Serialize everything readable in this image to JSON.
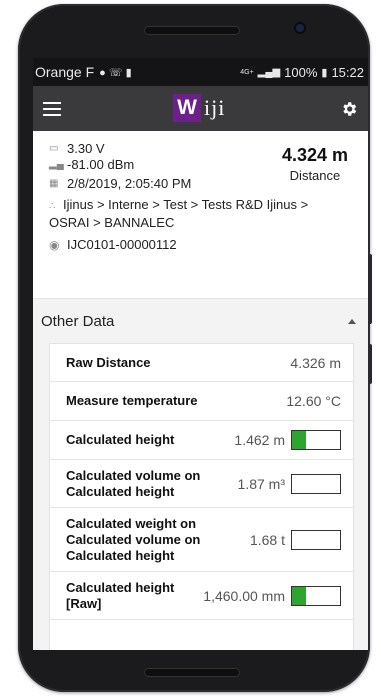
{
  "status": {
    "carrier": "Orange F",
    "battery": "100%",
    "network": "4G+",
    "time": "15:22"
  },
  "appbar": {
    "logo_mark": "W",
    "logo_text": "iji",
    "brand_color": "#6d1f8a"
  },
  "summary": {
    "voltage": "3.30 V",
    "signal": "-81.00 dBm",
    "datetime": "2/8/2019, 2:05:40 PM",
    "path": "Ijinus > Interne > Test > Tests R&D Ijinus > OSRAI > BANNALEC",
    "device_id": "IJC0101-00000112",
    "distance_value": "4.324 m",
    "distance_label": "Distance"
  },
  "other_data": {
    "title": "Other Data",
    "rows": [
      {
        "label": "Raw Distance",
        "value": "4.326 m"
      },
      {
        "label": "Measure temperature",
        "value": "12.60 °C"
      },
      {
        "label": "Calculated height",
        "value": "1.462 m",
        "level": 0.3
      },
      {
        "label": "Calculated volume on Calculated height",
        "value": "1.87 m³",
        "level": 0.0
      },
      {
        "label": "Calculated weight on Calculated volume on Calculated height",
        "value": "1.68 t",
        "level": 0.0
      },
      {
        "label": "Calculated height [Raw]",
        "value": "1,460.00 mm",
        "level": 0.3
      }
    ]
  },
  "colors": {
    "gauge_fill": "#2ea52e",
    "appbar_bg": "#3a3a3c"
  }
}
